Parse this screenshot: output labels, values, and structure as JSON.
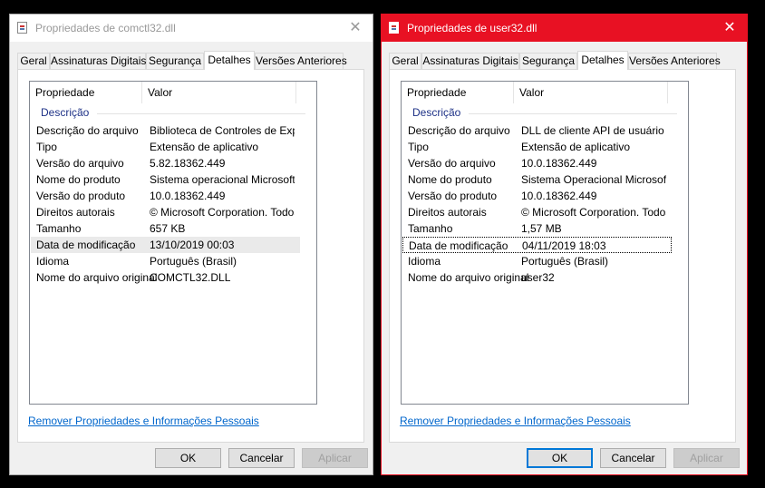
{
  "windows": [
    {
      "title": "Propriedades de comctl32.dll",
      "tabs": [
        "Geral",
        "Assinaturas Digitais",
        "Segurança",
        "Detalhes",
        "Versões Anteriores"
      ],
      "active_tab": "Detalhes",
      "columns": [
        "Propriedade",
        "Valor"
      ],
      "group": "Descrição",
      "rows": [
        {
          "k": "Descrição do arquivo",
          "v": "Biblioteca de Controles de Expe..."
        },
        {
          "k": "Tipo",
          "v": "Extensão de aplicativo"
        },
        {
          "k": "Versão do arquivo",
          "v": "5.82.18362.449"
        },
        {
          "k": "Nome do produto",
          "v": "Sistema operacional Microsoft®..."
        },
        {
          "k": "Versão do produto",
          "v": "10.0.18362.449"
        },
        {
          "k": "Direitos autorais",
          "v": "© Microsoft Corporation. Todos ..."
        },
        {
          "k": "Tamanho",
          "v": "657 KB"
        },
        {
          "k": "Data de modificação",
          "v": "13/10/2019 00:03"
        },
        {
          "k": "Idioma",
          "v": "Português (Brasil)"
        },
        {
          "k": "Nome do arquivo original",
          "v": "COMCTL32.DLL"
        }
      ],
      "selected_row": 7,
      "link": "Remover Propriedades e Informações Pessoais",
      "buttons": {
        "ok": "OK",
        "cancel": "Cancelar",
        "apply": "Aplicar"
      }
    },
    {
      "title": "Propriedades de user32.dll",
      "tabs": [
        "Geral",
        "Assinaturas Digitais",
        "Segurança",
        "Detalhes",
        "Versões Anteriores"
      ],
      "active_tab": "Detalhes",
      "columns": [
        "Propriedade",
        "Valor"
      ],
      "group": "Descrição",
      "rows": [
        {
          "k": "Descrição do arquivo",
          "v": "DLL de cliente API de usuário ..."
        },
        {
          "k": "Tipo",
          "v": "Extensão de aplicativo"
        },
        {
          "k": "Versão do arquivo",
          "v": "10.0.18362.449"
        },
        {
          "k": "Nome do produto",
          "v": "Sistema Operacional Microsoft®..."
        },
        {
          "k": "Versão do produto",
          "v": "10.0.18362.449"
        },
        {
          "k": "Direitos autorais",
          "v": "© Microsoft Corporation. Todos ..."
        },
        {
          "k": "Tamanho",
          "v": "1,57 MB"
        },
        {
          "k": "Data de modificação",
          "v": "04/11/2019 18:03"
        },
        {
          "k": "Idioma",
          "v": "Português (Brasil)"
        },
        {
          "k": "Nome do arquivo original",
          "v": "user32"
        }
      ],
      "selected_row": 7,
      "link": "Remover Propriedades e Informações Pessoais",
      "buttons": {
        "ok": "OK",
        "cancel": "Cancelar",
        "apply": "Aplicar"
      }
    }
  ],
  "icons": {
    "title": "dll-file-icon",
    "close": "close-icon"
  },
  "colors": {
    "active_title": "#e81123",
    "group_header": "#1e3287",
    "link": "#0066cc"
  }
}
